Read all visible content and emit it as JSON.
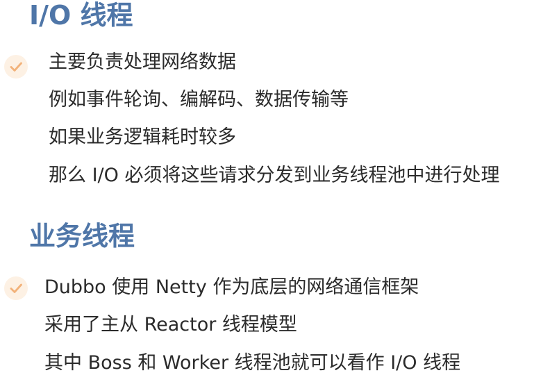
{
  "sections": [
    {
      "title": "I/O 线程",
      "lines": [
        "主要负责处理网络数据",
        "例如事件轮询、编解码、数据传输等",
        "如果业务逻辑耗时较多",
        "那么 I/O 必须将这些请求分发到业务线程池中进行处理"
      ]
    },
    {
      "title": "业务线程",
      "lines": [
        "Dubbo 使用 Netty 作为底层的网络通信框架",
        "采用了主从 Reactor 线程模型",
        "其中 Boss 和 Worker 线程池就可以看作 I/O 线程"
      ]
    }
  ],
  "colors": {
    "heading": "#4f76a8",
    "text": "#2b2b2b",
    "check_bg": "#fdf1e4",
    "check_mark": "#f2b27a"
  },
  "icons": {
    "bullet": "check-icon"
  }
}
